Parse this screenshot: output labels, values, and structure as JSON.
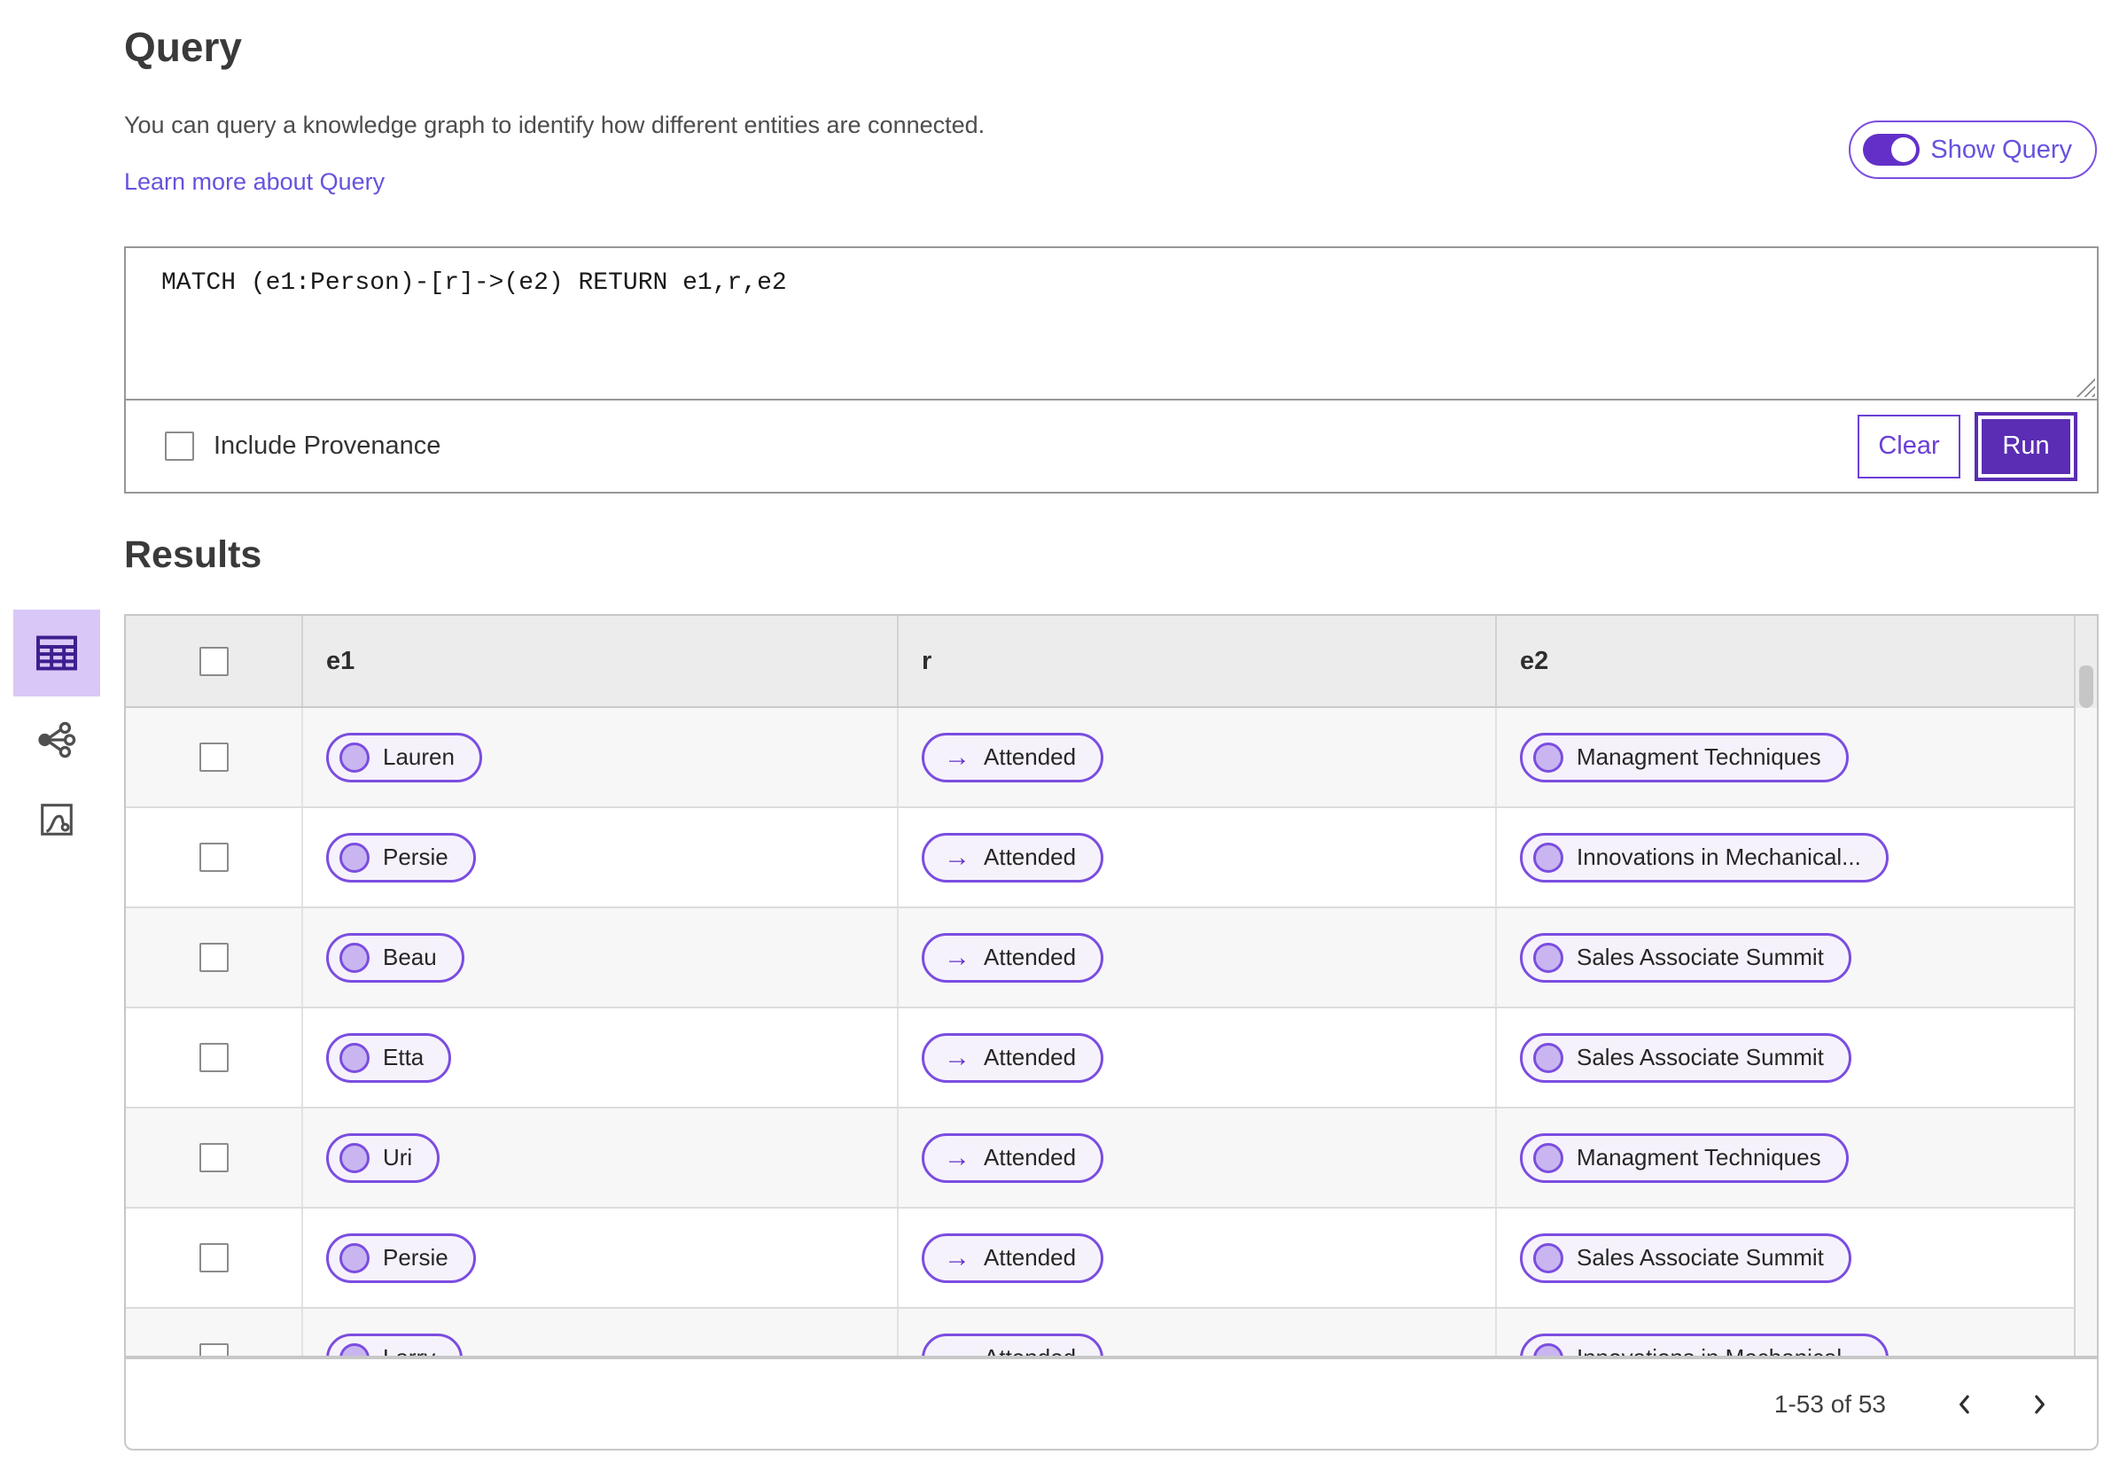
{
  "header": {
    "title": "Query",
    "description": "You can query a knowledge graph to identify how different entities are connected.",
    "learn_more_link": "Learn more about Query",
    "show_query_label": "Show Query",
    "show_query_state": "on"
  },
  "query_panel": {
    "query_text": "MATCH (e1:Person)-[r]->(e2) RETURN e1,r,e2",
    "include_provenance_label": "Include Provenance",
    "include_provenance_checked": false,
    "clear_label": "Clear",
    "run_label": "Run"
  },
  "results": {
    "title": "Results",
    "columns": [
      "e1",
      "r",
      "e2"
    ],
    "rows": [
      {
        "e1": "Lauren",
        "r": "Attended",
        "e2": "Managment Techniques"
      },
      {
        "e1": "Persie",
        "r": "Attended",
        "e2": "Innovations in Mechanical..."
      },
      {
        "e1": "Beau",
        "r": "Attended",
        "e2": "Sales Associate Summit"
      },
      {
        "e1": "Etta",
        "r": "Attended",
        "e2": "Sales Associate Summit"
      },
      {
        "e1": "Uri",
        "r": "Attended",
        "e2": "Managment Techniques"
      },
      {
        "e1": "Persie",
        "r": "Attended",
        "e2": "Sales Associate Summit"
      },
      {
        "e1": "Larry",
        "r": "Attended",
        "e2": "Innovations in Mechanical..."
      }
    ],
    "pagination": {
      "range_label": "1-53 of 53"
    }
  },
  "sidebar": {
    "items": [
      {
        "name": "table-view",
        "selected": true
      },
      {
        "name": "network-view",
        "selected": false
      },
      {
        "name": "plot-view",
        "selected": false
      }
    ]
  },
  "icons": {
    "relation_arrow": "→"
  },
  "colors": {
    "accent_purple": "#5a2db4",
    "pill_border": "#7b4de0",
    "pill_fill": "#f6f2fc",
    "node_fill": "#c9b6f0",
    "link_purple": "#6553de",
    "sidebar_selected_bg": "#d9c8f7",
    "table_header_gray": "#ececec"
  }
}
